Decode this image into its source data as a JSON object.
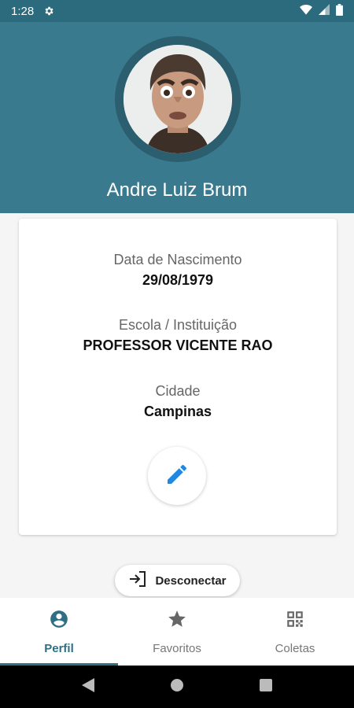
{
  "status_bar": {
    "time": "1:28"
  },
  "profile": {
    "name": "Andre Luiz Brum",
    "fields": [
      {
        "label": "Data de Nascimento",
        "value": "29/08/1979"
      },
      {
        "label": "Escola / Instituição",
        "value": "PROFESSOR VICENTE RAO"
      },
      {
        "label": "Cidade",
        "value": "Campinas"
      }
    ]
  },
  "actions": {
    "logout_label": "Desconectar"
  },
  "bottom_nav": {
    "tabs": [
      {
        "label": "Perfil",
        "icon": "account-circle-icon",
        "active": true
      },
      {
        "label": "Favoritos",
        "icon": "star-icon",
        "active": false
      },
      {
        "label": "Coletas",
        "icon": "qr-code-icon",
        "active": false
      }
    ]
  },
  "colors": {
    "header": "#3a7a8e",
    "status_bar": "#2c6a7d",
    "accent": "#2e6f84",
    "edit_icon": "#1e88e5"
  }
}
